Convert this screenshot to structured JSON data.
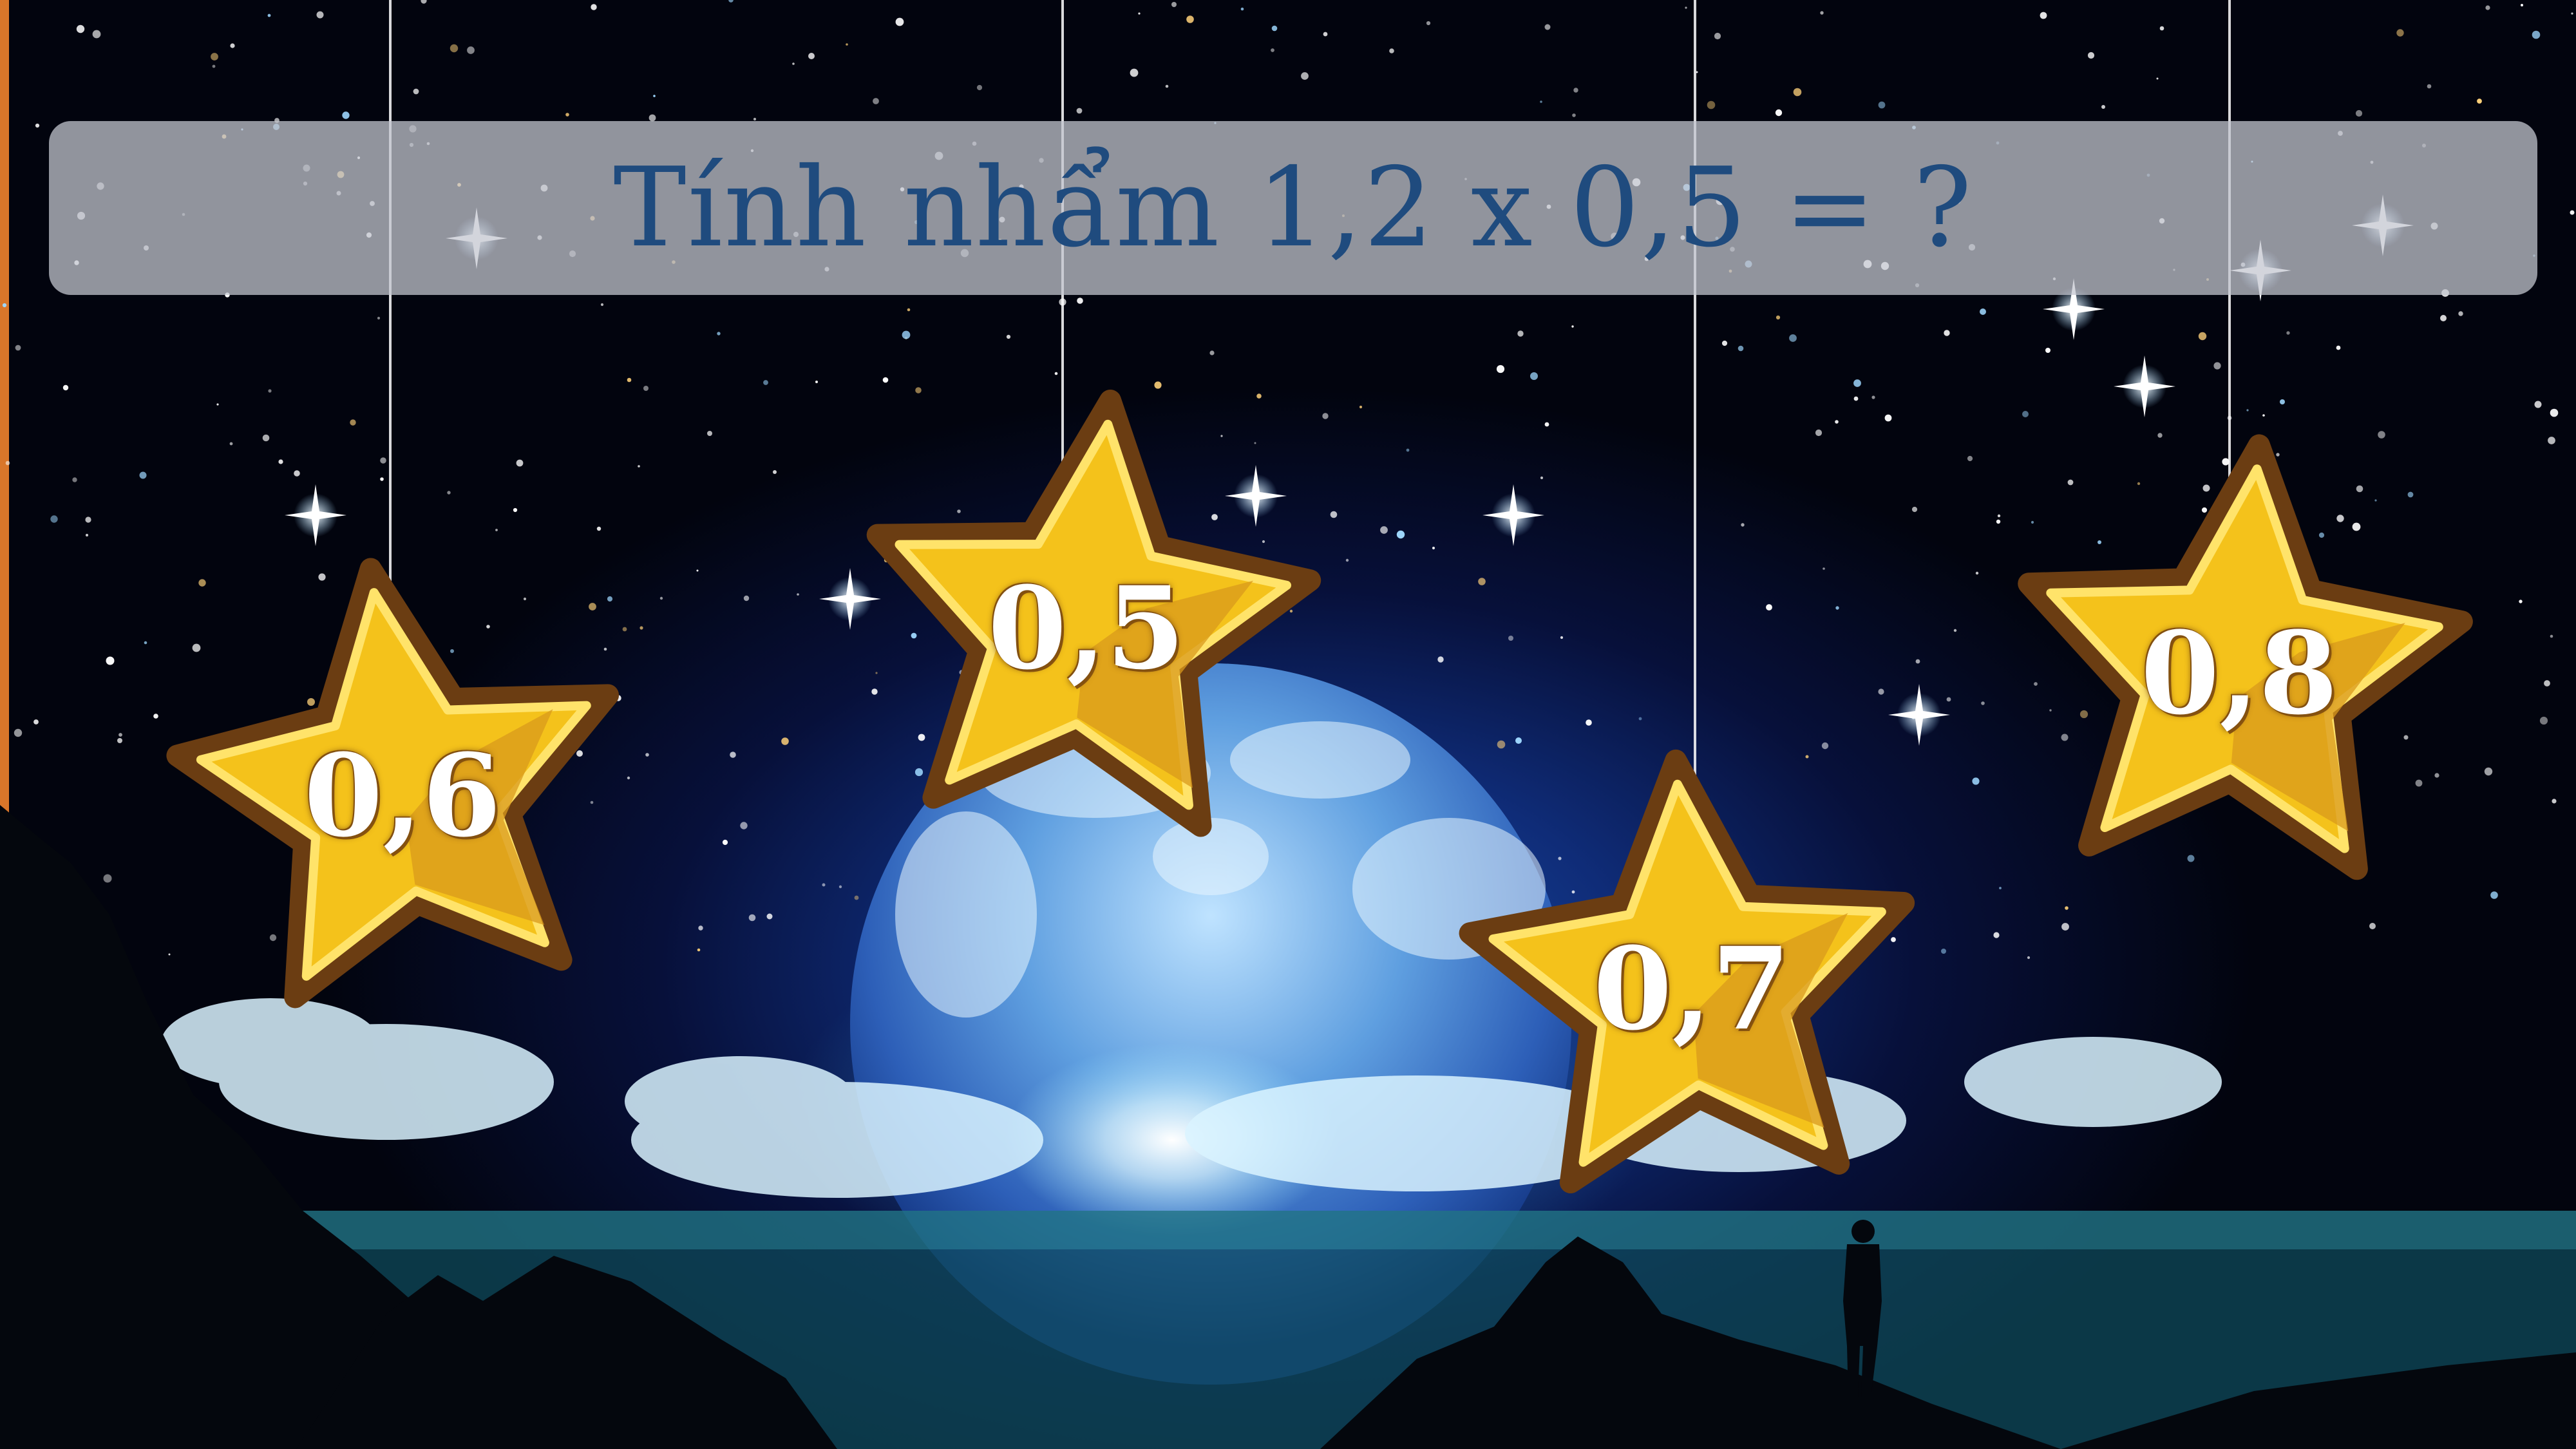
{
  "question": {
    "title": "Tính nhẩm 1,2 x 0,5 = ?"
  },
  "answers": [
    {
      "label": "0,6"
    },
    {
      "label": "0,5"
    },
    {
      "label": "0,7"
    },
    {
      "label": "0,8"
    }
  ],
  "colors": {
    "title_text": "#1f4b7e",
    "star_outline": "#6b3d12",
    "star_fill": "#f4c21b",
    "star_shade": "#d99a1c"
  },
  "icons": {
    "answer_shape": "star-icon"
  }
}
